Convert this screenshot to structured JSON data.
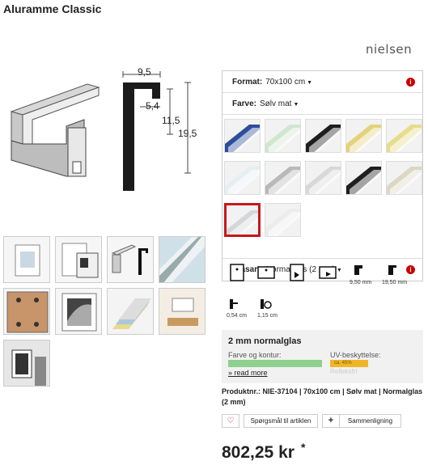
{
  "header": {
    "title": "Aluramme Classic",
    "brand": "nielsen"
  },
  "profile": {
    "width": "9,5",
    "lip": "5,4",
    "rebate": "11,5",
    "depth": "19,5"
  },
  "options": {
    "format_label": "Format:",
    "format_value": "70x100 cm",
    "color_label": "Farve:",
    "color_value": "Sølv mat",
    "glass_label": "Glasart:",
    "glass_value": "Normalglas (2 mm)",
    "info_icon": "info-icon"
  },
  "swatch_colors": [
    "#2d4e9c",
    "#cfe6cf",
    "#1e1e1e",
    "#e4d27a",
    "#e6dd8a",
    "#e6eef2",
    "#b9b9b9",
    "#d8d8d8",
    "#202020",
    "#dcd6c4",
    "#d4d6d8",
    "#ececec"
  ],
  "icon_labels": {
    "profile_width": "9,50 mm",
    "profile_depth": "19,50 mm",
    "rebate_a": "0,54 cm",
    "rebate_b": "1,15 cm"
  },
  "glass_info": {
    "title": "2 mm normalglas",
    "color_label": "Farve og kontur:",
    "uv_label": "UV-beskyttelse:",
    "uv_value": "ca. 45%",
    "faded": "Refleksfri",
    "read_more": "» read more"
  },
  "product_number": "Produktnr.: NIE-37104 | 70x100 cm | Sølv mat | Normalglas (2 mm)",
  "actions": {
    "ask": "Spørgsmål til artiklen",
    "compare": "Sammenligning"
  },
  "price": {
    "value": "802,25 kr",
    "asterisk": "*"
  },
  "colors": {
    "accent": "#c8171d",
    "info": "#cc0000"
  }
}
